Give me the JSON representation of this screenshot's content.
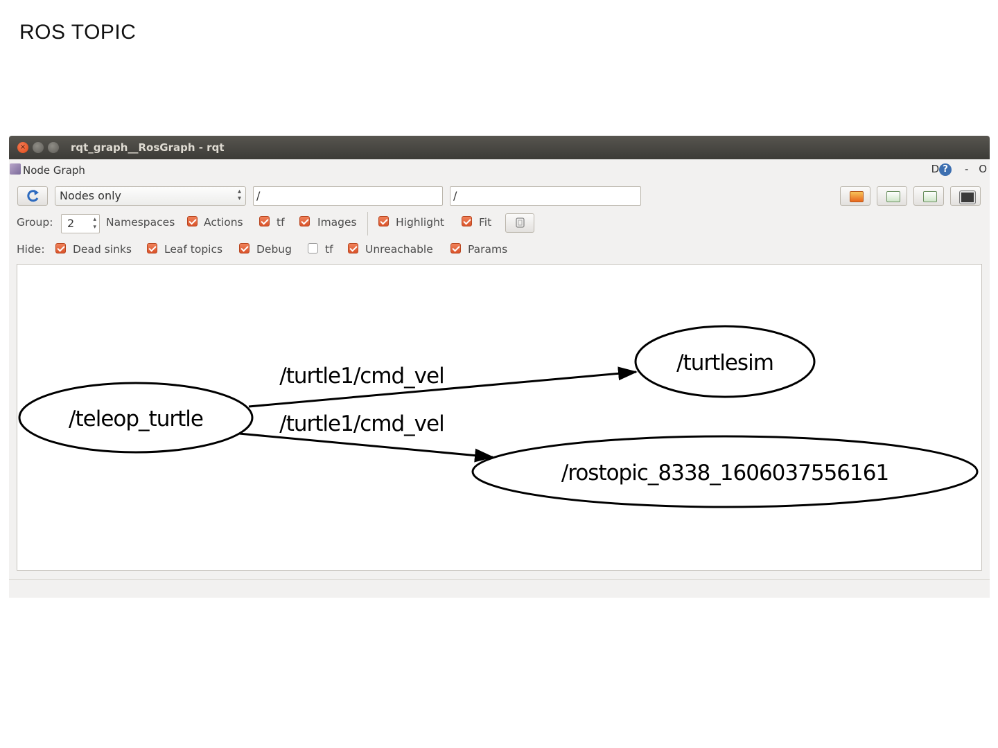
{
  "slide": {
    "title": "ROS TOPIC"
  },
  "window": {
    "title": "rqt_graph__RosGraph - rqt",
    "close_glyph": "×"
  },
  "plugin": {
    "title": "Node Graph",
    "right_text": "D",
    "help_glyph": "?",
    "dash": "-",
    "o": "O"
  },
  "toolbar": {
    "refresh_icon": "refresh-icon",
    "mode_select": "Nodes only",
    "node_filter": "/",
    "topic_filter": "/",
    "buttons": [
      "load-dot-icon",
      "save-dot-icon",
      "save-svg-icon",
      "save-image-icon"
    ]
  },
  "group_row": {
    "group_label": "Group:",
    "group_value": "2",
    "namespaces_label": "Namespaces",
    "items": [
      {
        "label": "Actions",
        "checked": true
      },
      {
        "label": "tf",
        "checked": true
      },
      {
        "label": "Images",
        "checked": true
      },
      {
        "label": "Highlight",
        "checked": true
      },
      {
        "label": "Fit",
        "checked": true
      }
    ]
  },
  "hide_row": {
    "hide_label": "Hide:",
    "items": [
      {
        "label": "Dead sinks",
        "checked": true
      },
      {
        "label": "Leaf topics",
        "checked": true
      },
      {
        "label": "Debug",
        "checked": true
      },
      {
        "label": "tf",
        "checked": false
      },
      {
        "label": "Unreachable",
        "checked": true
      },
      {
        "label": "Params",
        "checked": true
      }
    ]
  },
  "graph": {
    "nodes": [
      {
        "id": "teleop",
        "label": "/teleop_turtle"
      },
      {
        "id": "turtlesim",
        "label": "/turtlesim"
      },
      {
        "id": "rostopic",
        "label": "/rostopic_8338_1606037556161"
      }
    ],
    "edges": [
      {
        "from": "teleop",
        "to": "turtlesim",
        "label": "/turtle1/cmd_vel"
      },
      {
        "from": "teleop",
        "to": "rostopic",
        "label": "/turtle1/cmd_vel"
      }
    ]
  },
  "colors": {
    "titlebar": "#3c3b37",
    "checkbox_accent": "#e0582c",
    "window_bg": "#f2f1f0"
  }
}
